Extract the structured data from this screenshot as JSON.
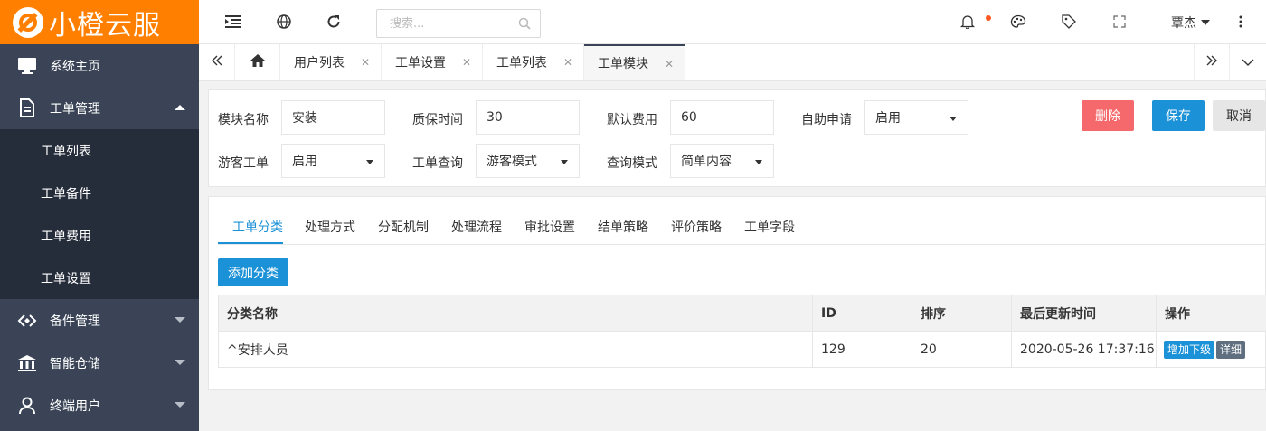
{
  "brand": {
    "name": "小橙云服",
    "color": "#ff7f00"
  },
  "sidebar": {
    "items": [
      {
        "label": "系统主页",
        "icon": "monitor-icon"
      },
      {
        "label": "工单管理",
        "icon": "document-icon",
        "expanded": true,
        "children": [
          "工单列表",
          "工单备件",
          "工单费用",
          "工单设置"
        ]
      },
      {
        "label": "备件管理",
        "icon": "parts-icon"
      },
      {
        "label": "智能仓储",
        "icon": "bank-icon"
      },
      {
        "label": "终端用户",
        "icon": "user-icon"
      }
    ]
  },
  "header": {
    "search_placeholder": "搜索...",
    "user_name": "覃杰",
    "notification_dot_color": "#ff5722"
  },
  "tabs": {
    "items": [
      {
        "label": "用户列表"
      },
      {
        "label": "工单设置"
      },
      {
        "label": "工单列表"
      },
      {
        "label": "工单模块",
        "active": true
      }
    ],
    "close_glyph": "✕"
  },
  "form": {
    "module_name_label": "模块名称",
    "module_name_value": "安装",
    "warranty_label": "质保时间",
    "warranty_value": "30",
    "default_fee_label": "默认费用",
    "default_fee_value": "60",
    "self_apply_label": "自助申请",
    "self_apply_value": "启用",
    "guest_ticket_label": "游客工单",
    "guest_ticket_value": "启用",
    "ticket_query_label": "工单查询",
    "ticket_query_value": "游客模式",
    "query_mode_label": "查询模式",
    "query_mode_value": "简单内容",
    "delete_label": "删除",
    "save_label": "保存",
    "cancel_label": "取消",
    "delete_color": "#f5686b",
    "save_color": "#1b91d7",
    "cancel_color": "#e6e6e6"
  },
  "content_tabs": [
    "工单分类",
    "处理方式",
    "分配机制",
    "处理流程",
    "审批设置",
    "结单策略",
    "评价策略",
    "工单字段"
  ],
  "add_category_label": "添加分类",
  "table": {
    "headers": [
      "分类名称",
      "ID",
      "排序",
      "最后更新时间",
      "操作"
    ],
    "rows": [
      {
        "name": "^安排人员",
        "id": "129",
        "sort": "20",
        "updated": "2020-05-26 17:37:16",
        "actions": [
          "增加下级",
          "详细"
        ]
      }
    ]
  },
  "colors": {
    "sidebar_bg": "#3a4456",
    "subnav_bg": "#252c3a",
    "primary": "#1b91d7"
  }
}
